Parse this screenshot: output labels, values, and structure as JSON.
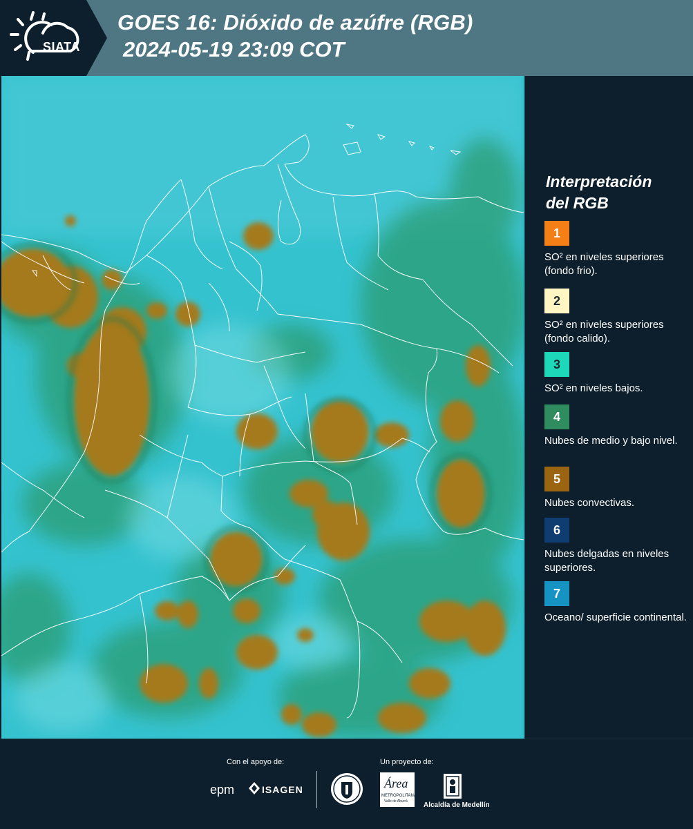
{
  "header": {
    "logo_text": "SIATA",
    "title": "GOES 16: Dióxido de azúfre (RGB)",
    "timestamp": "2024-05-19 23:09 COT"
  },
  "legend": {
    "title_line1": "Interpretación",
    "title_line2": "del RGB",
    "items": [
      {
        "num": "1",
        "color": "#f57f17",
        "label": "SO² en niveles superiores (fondo frio)."
      },
      {
        "num": "2",
        "color": "#fff6c3",
        "label": "SO² en niveles superiores (fondo calido)."
      },
      {
        "num": "3",
        "color": "#1ed9b9",
        "label": "SO² en niveles bajos."
      },
      {
        "num": "4",
        "color": "#2f8c5e",
        "label": "Nubes de medio y bajo nivel."
      },
      {
        "num": "5",
        "color": "#9a6410",
        "label": "Nubes convectivas."
      },
      {
        "num": "6",
        "color": "#0f3d72",
        "label": "Nubes delgadas en niveles superiores."
      },
      {
        "num": "7",
        "color": "#1593c2",
        "label": "Oceano/ superficie continental."
      }
    ]
  },
  "footer": {
    "support_label": "Con el apoyo de:",
    "project_label": "Un proyecto de:",
    "sponsor_epm": "epm",
    "sponsor_isagen": "ISAGEN",
    "partner_area": "Área",
    "partner_area_sub": "METROPOLITANA",
    "partner_area_sub2": "Valle de Aburrá",
    "partner_alcaldia": "Alcaldía de Medellín"
  },
  "map": {
    "image_colors": {
      "ocean": "#35c2cf",
      "convective": "#a47a1f",
      "mid_cloud": "#2a9c72",
      "border": "#ffffff"
    }
  }
}
